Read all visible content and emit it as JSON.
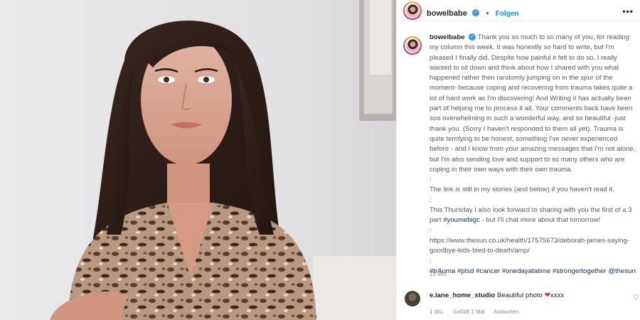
{
  "post": {
    "username": "bowelbabe",
    "verified_symbol": "✓",
    "separator": "•",
    "follow_label": "Folgen",
    "more_label": "•••"
  },
  "caption": {
    "username": "bowelbabe",
    "verified_symbol": "✓",
    "body": "Thank you so much to so many of you, for reading my column this week. It was honestly so hard to write, but I'm pleased I finally did. Despite how painful it felt to do so. I really wanted to sit down and think about how I shared with you what happened rather then randomly jumping on in the spur of the moment- because coping and recovering from trauma takes quite a lot of hard work as I'm discovering! And Writing it has actually been part of helping me to process it all. Your comments back have been soo overwhelming in such a wonderful way, and so beautiful -just thank you. (Sorry I haven't responded to them all yet). Trauma is quite terrifying to be honest, something I've never experienced before - and I know from your amazing messages that I'm not alone, but I'm also sending love and support to so many others who are coping in their own ways with their own trauma.",
    "sep1": ":",
    "link_line": "The link is still in my stories (and below) if you haven't read it.",
    "sep2": ":",
    "thursday_pre": "This Thursday I also look forward to sharing with you the first of a 3 part ",
    "thursday_tag": "#youmebigc",
    "thursday_post": " - but I'll chat more about that tomorrow!",
    "sep3": ":",
    "url": "https://www.thesun.co.uk/health/17575673/deborah-james-saying-goodbye-kids-bled-to-death/amp/",
    "sep4": ":",
    "hashtags": [
      "#trAuma",
      "#ptsd",
      "#cancer",
      "#onedayatatime",
      "#strongertogether"
    ],
    "mention": "@thesun",
    "time": "15 Wo."
  },
  "comment": {
    "username": "e.lane_home_studio",
    "text": "Beautiful photo",
    "heart": "❤",
    "suffix": "xxxx",
    "time": "1 Wo.",
    "likes": "Gefällt 1 Mal",
    "reply_label": "Antworten",
    "like_icon": "♡"
  }
}
